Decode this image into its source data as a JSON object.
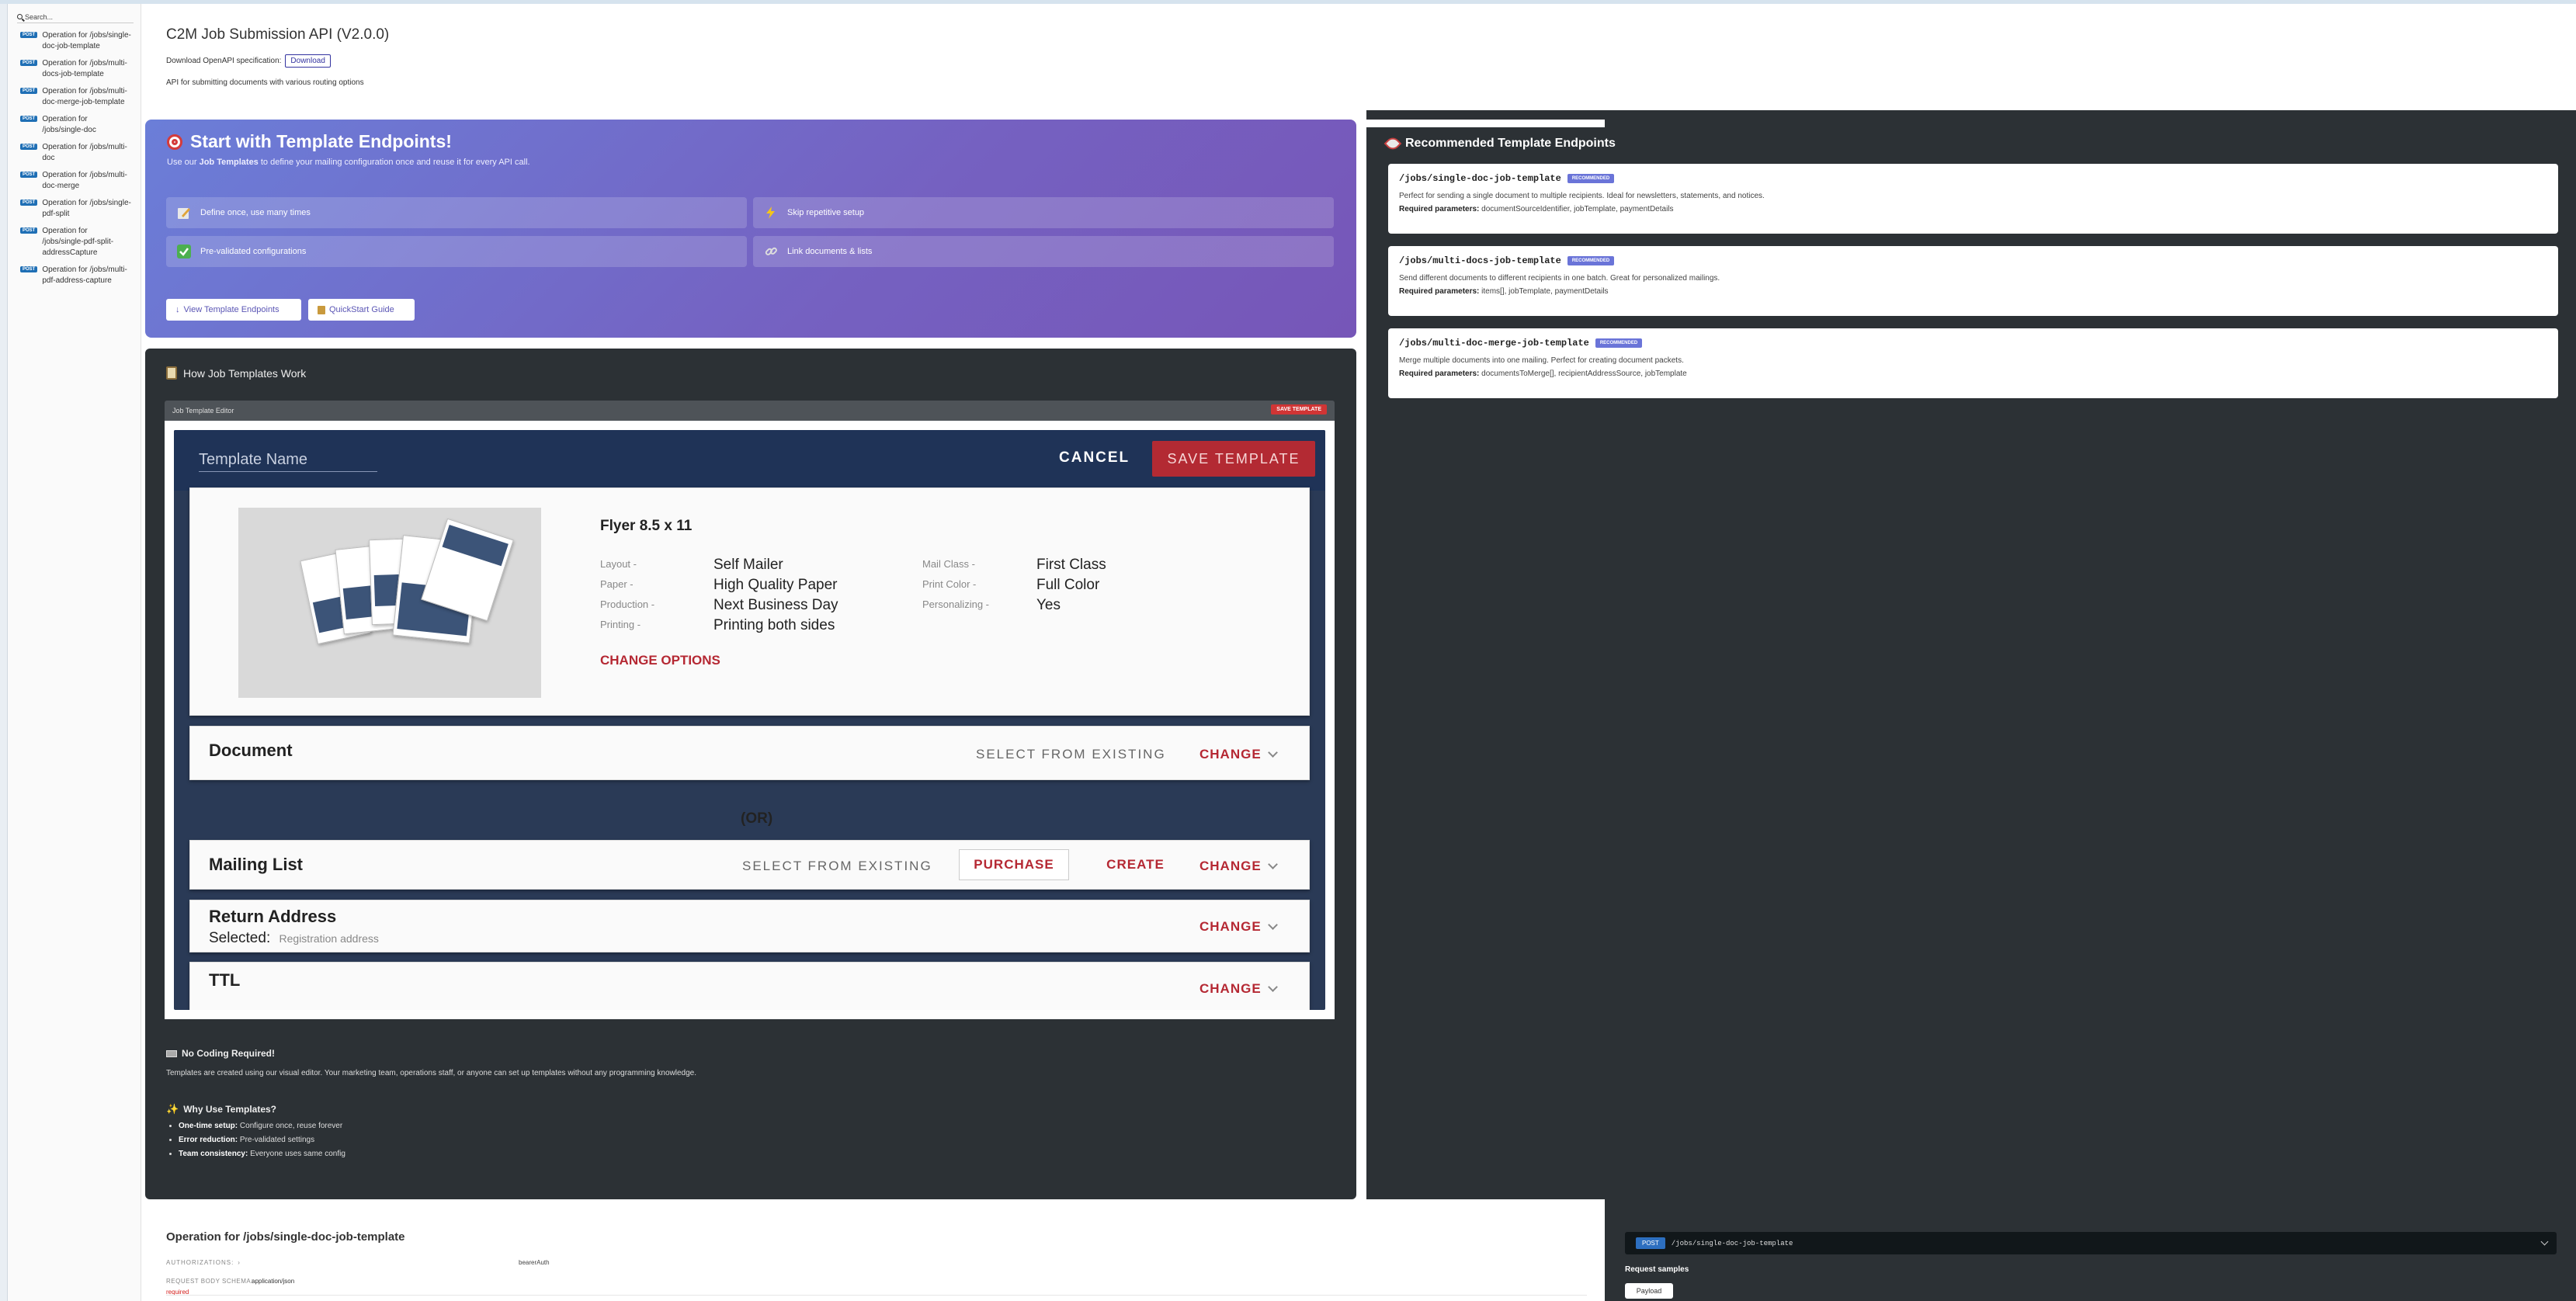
{
  "sidebar": {
    "search_placeholder": "Search...",
    "method_badge": "POST",
    "items": [
      {
        "label": "Operation for /jobs/single-doc-job-template"
      },
      {
        "label": "Operation for /jobs/multi-docs-job-template"
      },
      {
        "label": "Operation for /jobs/multi-doc-merge-job-template"
      },
      {
        "label": "Operation for /jobs/single-doc"
      },
      {
        "label": "Operation for /jobs/multi-doc"
      },
      {
        "label": "Operation for /jobs/multi-doc-merge"
      },
      {
        "label": "Operation for /jobs/single-pdf-split"
      },
      {
        "label": "Operation for /jobs/single-pdf-split-addressCapture"
      },
      {
        "label": "Operation for /jobs/multi-pdf-address-capture"
      }
    ]
  },
  "header": {
    "title": "C2M Job Submission API (V2.0.0)",
    "download_label": "Download OpenAPI specification:",
    "download_button": "Download",
    "description": "API for submitting documents with various routing options"
  },
  "hero": {
    "title": "Start with Template Endpoints!",
    "sub_prefix": "Use our",
    "sub_bold": "Job Templates",
    "sub_suffix": "to define your mailing configuration once and reuse it for every API call.",
    "features": [
      {
        "icon": "pencil-icon",
        "label": "Define once, use many times"
      },
      {
        "icon": "lightning-icon",
        "label": "Skip repetitive setup"
      },
      {
        "icon": "checkmark-icon",
        "label": "Pre-validated configurations"
      },
      {
        "icon": "link-icon",
        "label": "Link documents & lists"
      }
    ],
    "btn_view": "View Template Endpoints",
    "btn_quickstart": "QuickStart Guide"
  },
  "how": {
    "title": "How Job Templates Work",
    "editor_label": "Job Template Editor",
    "editor_save": "SAVE TEMPLATE",
    "shot": {
      "template_name": "Template Name",
      "cancel": "CANCEL",
      "save": "SAVE TEMPLATE",
      "flyer_title": "Flyer 8.5 x 11",
      "specs_left": [
        {
          "label": "Layout -",
          "value": "Self Mailer"
        },
        {
          "label": "Paper -",
          "value": "High Quality Paper"
        },
        {
          "label": "Production -",
          "value": "Next Business Day"
        },
        {
          "label": "Printing -",
          "value": "Printing both sides"
        }
      ],
      "specs_right": [
        {
          "label": "Mail Class -",
          "value": "First Class"
        },
        {
          "label": "Print Color -",
          "value": "Full Color"
        },
        {
          "label": "Personalizing -",
          "value": "Yes"
        }
      ],
      "change_options": "CHANGE OPTIONS",
      "document": "Document",
      "select_existing": "SELECT FROM EXISTING",
      "change": "CHANGE",
      "or": "(OR)",
      "mailing_list": "Mailing List",
      "purchase": "PURCHASE",
      "create": "CREATE",
      "return_address": "Return Address",
      "selected": "Selected:",
      "registration": "Registration address",
      "ttl": "TTL"
    },
    "no_code_title": "No Coding Required!",
    "no_code_desc": "Templates are created using our visual editor. Your marketing team, operations staff, or anyone can set up templates without any programming knowledge.",
    "why_title": "Why Use Templates?",
    "why_items": [
      {
        "bold": "One-time setup:",
        "text": "Configure once, reuse forever"
      },
      {
        "bold": "Error reduction:",
        "text": "Pre-validated settings"
      },
      {
        "bold": "Team consistency:",
        "text": "Everyone uses same config"
      }
    ]
  },
  "recommended": {
    "title": "Recommended Template Endpoints",
    "badge": "RECOMMENDED",
    "req_label": "Required parameters:",
    "endpoints": [
      {
        "path": "/jobs/single-doc-job-template",
        "desc": "Perfect for sending a single document to multiple recipients. Ideal for newsletters, statements, and notices.",
        "params": "documentSourceIdentifier, jobTemplate, paymentDetails"
      },
      {
        "path": "/jobs/multi-docs-job-template",
        "desc": "Send different documents to different recipients in one batch. Great for personalized mailings.",
        "params": "items[], jobTemplate, paymentDetails"
      },
      {
        "path": "/jobs/multi-doc-merge-job-template",
        "desc": "Merge multiple documents into one mailing. Perfect for creating document packets.",
        "params": "documentsToMerge[], recipientAddressSource, jobTemplate"
      }
    ]
  },
  "operation": {
    "title": "Operation for /jobs/single-doc-job-template",
    "auth_label": "AUTHORIZATIONS:",
    "auth_value": "bearerAuth",
    "body_label": "REQUEST BODY SCHEMA:",
    "body_value": "application/json",
    "required": "required",
    "method": "POST",
    "path": "/jobs/single-doc-job-template",
    "samples": "Request samples",
    "payload": "Payload"
  }
}
